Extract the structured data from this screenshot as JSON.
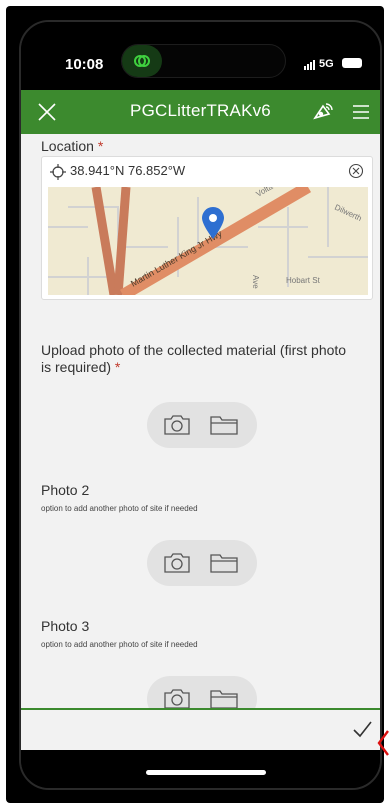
{
  "status_bar": {
    "time": "10:08",
    "network": "5G"
  },
  "app": {
    "title": "PGCLitterTRAKv6"
  },
  "location": {
    "label": "Location",
    "required_mark": "*",
    "coordinates": "38.941°N 76.852°W",
    "map_labels": [
      "Volta",
      "Dilwerth",
      "Martin Luther King Jr Hwy",
      "Hobart St",
      "Ave"
    ]
  },
  "photo1": {
    "label": "Upload photo of the collected material (first photo",
    "label_cont": "is required)",
    "required_mark": "*"
  },
  "photo2": {
    "label": "Photo 2",
    "hint": "option to add another photo of site if needed"
  },
  "photo3": {
    "label": "Photo 3",
    "hint": "option to add another photo of site if needed"
  },
  "colors": {
    "header_green": "#3c8a2e",
    "required_red": "#c0392b"
  },
  "icons": [
    "close-icon",
    "gps-icon",
    "menu-icon",
    "crosshair-icon",
    "clear-icon",
    "map-pin-icon",
    "camera-icon",
    "folder-icon",
    "checkmark-icon"
  ]
}
